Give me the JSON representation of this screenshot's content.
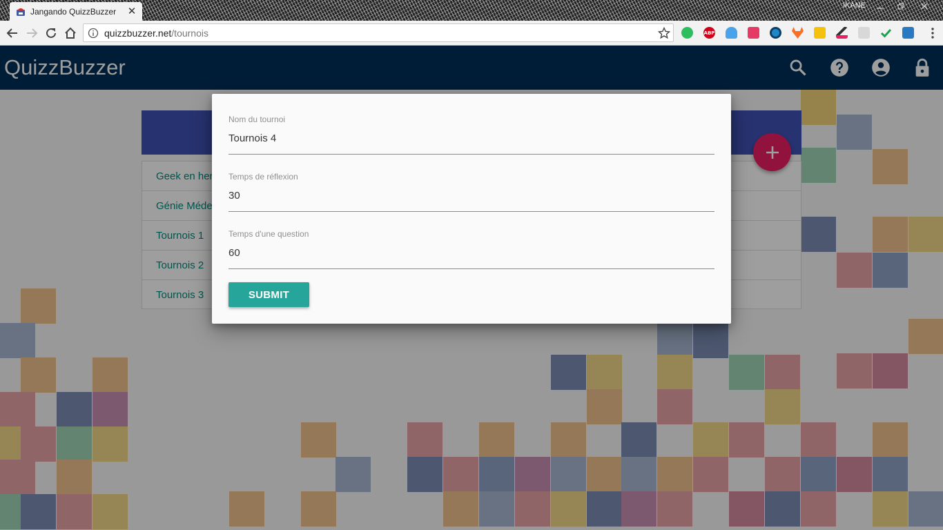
{
  "browser": {
    "tab_title": "Jangando QuizzBuzzer",
    "tab_close": "✕",
    "profile_name": "IKANE",
    "url_host": "quizzbuzzer.net",
    "url_path": "/tournois",
    "extensions": [
      "evernote-icon",
      "adblock-icon",
      "cloud-icon",
      "video-icon",
      "eye-icon",
      "gitlab-icon",
      "notes-icon",
      "colorpicker-icon",
      "chat-icon",
      "check-icon",
      "share-icon"
    ]
  },
  "app": {
    "brand": "QuizzBuzzer",
    "accent": "#00305a",
    "tournaments": [
      "Geek en herbe",
      "Génie Médecine",
      "Tournois 1",
      "Tournois 2",
      "Tournois 3"
    ]
  },
  "dialog": {
    "fields": [
      {
        "label": "Nom du tournoi",
        "value": "Tournois 4"
      },
      {
        "label": "Temps de réflexion",
        "value": "30"
      },
      {
        "label": "Temps d'une question",
        "value": "60"
      }
    ],
    "submit_label": "SUBMIT"
  }
}
